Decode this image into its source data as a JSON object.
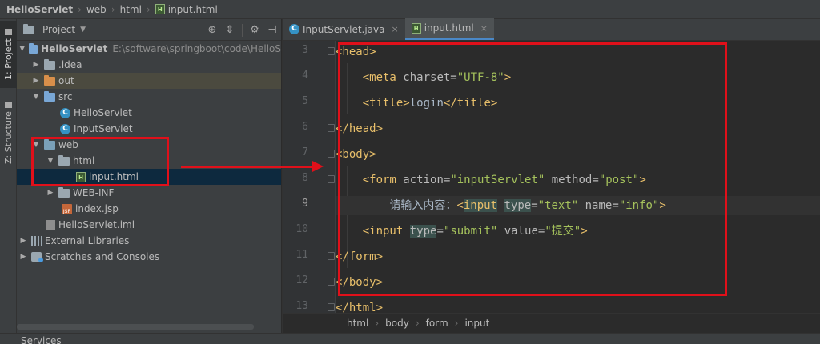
{
  "breadcrumb": {
    "project": "HelloServlet",
    "folder1": "web",
    "folder2": "html",
    "file": "input.html"
  },
  "stripe": {
    "project_tab": "1: Project",
    "structure_tab": "Z: Structure"
  },
  "project_panel": {
    "title": "Project",
    "tree": {
      "root": "HelloServlet",
      "root_path": "E:\\software\\springboot\\code\\HelloS",
      "idea": ".idea",
      "out": "out",
      "src": "src",
      "class1": "HelloServlet",
      "class2": "InputServlet",
      "web": "web",
      "html": "html",
      "input_file": "input.html",
      "webinf": "WEB-INF",
      "index": "index.jsp",
      "iml": "HelloServlet.iml",
      "libs": "External Libraries",
      "scratches": "Scratches and Consoles"
    }
  },
  "tabs": [
    {
      "label": "InputServlet.java"
    },
    {
      "label": "input.html"
    }
  ],
  "code": {
    "line_numbers": [
      "3",
      "4",
      "5",
      "6",
      "7",
      "8",
      "9",
      "10",
      "11",
      "12",
      "13"
    ],
    "l3_tag": "<head>",
    "l4_open": "<meta ",
    "l4_attr": "charset=",
    "l4_str": "\"UTF-8\"",
    "l4_close": ">",
    "l5_open": "<title>",
    "l5_text": "login",
    "l5_close": "</title>",
    "l6_tag": "</head>",
    "l7_tag": "<body>",
    "l8_open": "<form ",
    "l8_a1": "action=",
    "l8_s1": "\"inputServlet\"",
    "l8_a2": " method=",
    "l8_s2": "\"post\"",
    "l8_close": ">",
    "l9_text": "请输入内容：",
    "l9_open_lt": "<",
    "l9_input": "input",
    "l9_type_a": "ty",
    "l9_type_b": "pe",
    "l9_eq": "=",
    "l9_s1": "\"text\"",
    "l9_a2": " name=",
    "l9_s2": "\"info\"",
    "l9_close": ">",
    "l10_open": "<input ",
    "l10_type": "type",
    "l10_eq": "=",
    "l10_s1": "\"submit\"",
    "l10_a2": " value=",
    "l10_s2": "\"提交\"",
    "l10_close": ">",
    "l11_tag": "</form>",
    "l12_tag": "</body>",
    "l13_tag": "</html>"
  },
  "editor_breadcrumb": [
    "html",
    "body",
    "form",
    "input"
  ],
  "bottom": {
    "services": "Services"
  },
  "colors": {
    "annotation_red": "#e0101a",
    "tag": "#e8bf6a",
    "string": "#a5c25c",
    "accent_tab": "#4a88c7"
  }
}
